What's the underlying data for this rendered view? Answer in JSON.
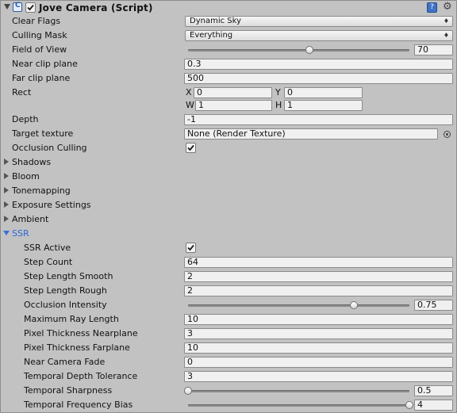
{
  "component": {
    "title": "Jove Camera (Script)",
    "enabled": true,
    "icons": [
      "script-component-icon",
      "help-icon",
      "gear-icon"
    ]
  },
  "fields": {
    "clear_flags": {
      "label": "Clear Flags",
      "value": "Dynamic Sky"
    },
    "culling_mask": {
      "label": "Culling Mask",
      "value": "Everything"
    },
    "field_of_view": {
      "label": "Field of View",
      "value": "70",
      "fraction": 0.55
    },
    "near_clip": {
      "label": "Near clip plane",
      "value": "0.3"
    },
    "far_clip": {
      "label": "Far clip plane",
      "value": "500"
    },
    "rect": {
      "label": "Rect",
      "x_label": "X",
      "x": "0",
      "y_label": "Y",
      "y": "0",
      "w_label": "W",
      "w": "1",
      "h_label": "H",
      "h": "1"
    },
    "depth": {
      "label": "Depth",
      "value": "-1"
    },
    "target_texture": {
      "label": "Target texture",
      "value": "None (Render Texture)"
    },
    "occlusion_culling": {
      "label": "Occlusion Culling",
      "checked": true
    }
  },
  "sections": {
    "shadows": "Shadows",
    "bloom": "Bloom",
    "tonemapping": "Tonemapping",
    "exposure": "Exposure Settings",
    "ambient": "Ambient",
    "ssr": "SSR"
  },
  "ssr": {
    "active": {
      "label": "SSR Active",
      "checked": true
    },
    "step_count": {
      "label": "Step Count",
      "value": "64"
    },
    "step_length_smooth": {
      "label": "Step Length Smooth",
      "value": "2"
    },
    "step_length_rough": {
      "label": "Step Length Rough",
      "value": "2"
    },
    "occlusion_intensity": {
      "label": "Occlusion Intensity",
      "value": "0.75",
      "fraction": 0.75
    },
    "max_ray_length": {
      "label": "Maximum Ray Length",
      "value": "10"
    },
    "pixel_thickness_near": {
      "label": "Pixel Thickness Nearplane",
      "value": "3"
    },
    "pixel_thickness_far": {
      "label": "Pixel Thickness Farplane",
      "value": "10"
    },
    "near_camera_fade": {
      "label": "Near Camera Fade",
      "value": "0"
    },
    "temporal_depth_tolerance": {
      "label": "Temporal Depth Tolerance",
      "value": "3"
    },
    "temporal_sharpness": {
      "label": "Temporal Sharpness",
      "value": "0.5",
      "fraction": 0.0
    },
    "temporal_frequency_bias": {
      "label": "Temporal Frequency Bias",
      "value": "4",
      "fraction": 1.0
    }
  },
  "colors": {
    "panel_bg": "#c2c2c2",
    "field_bg": "#f0f0f0",
    "accent_blue": "#2b66d8",
    "help_blue": "#3f73c5"
  }
}
